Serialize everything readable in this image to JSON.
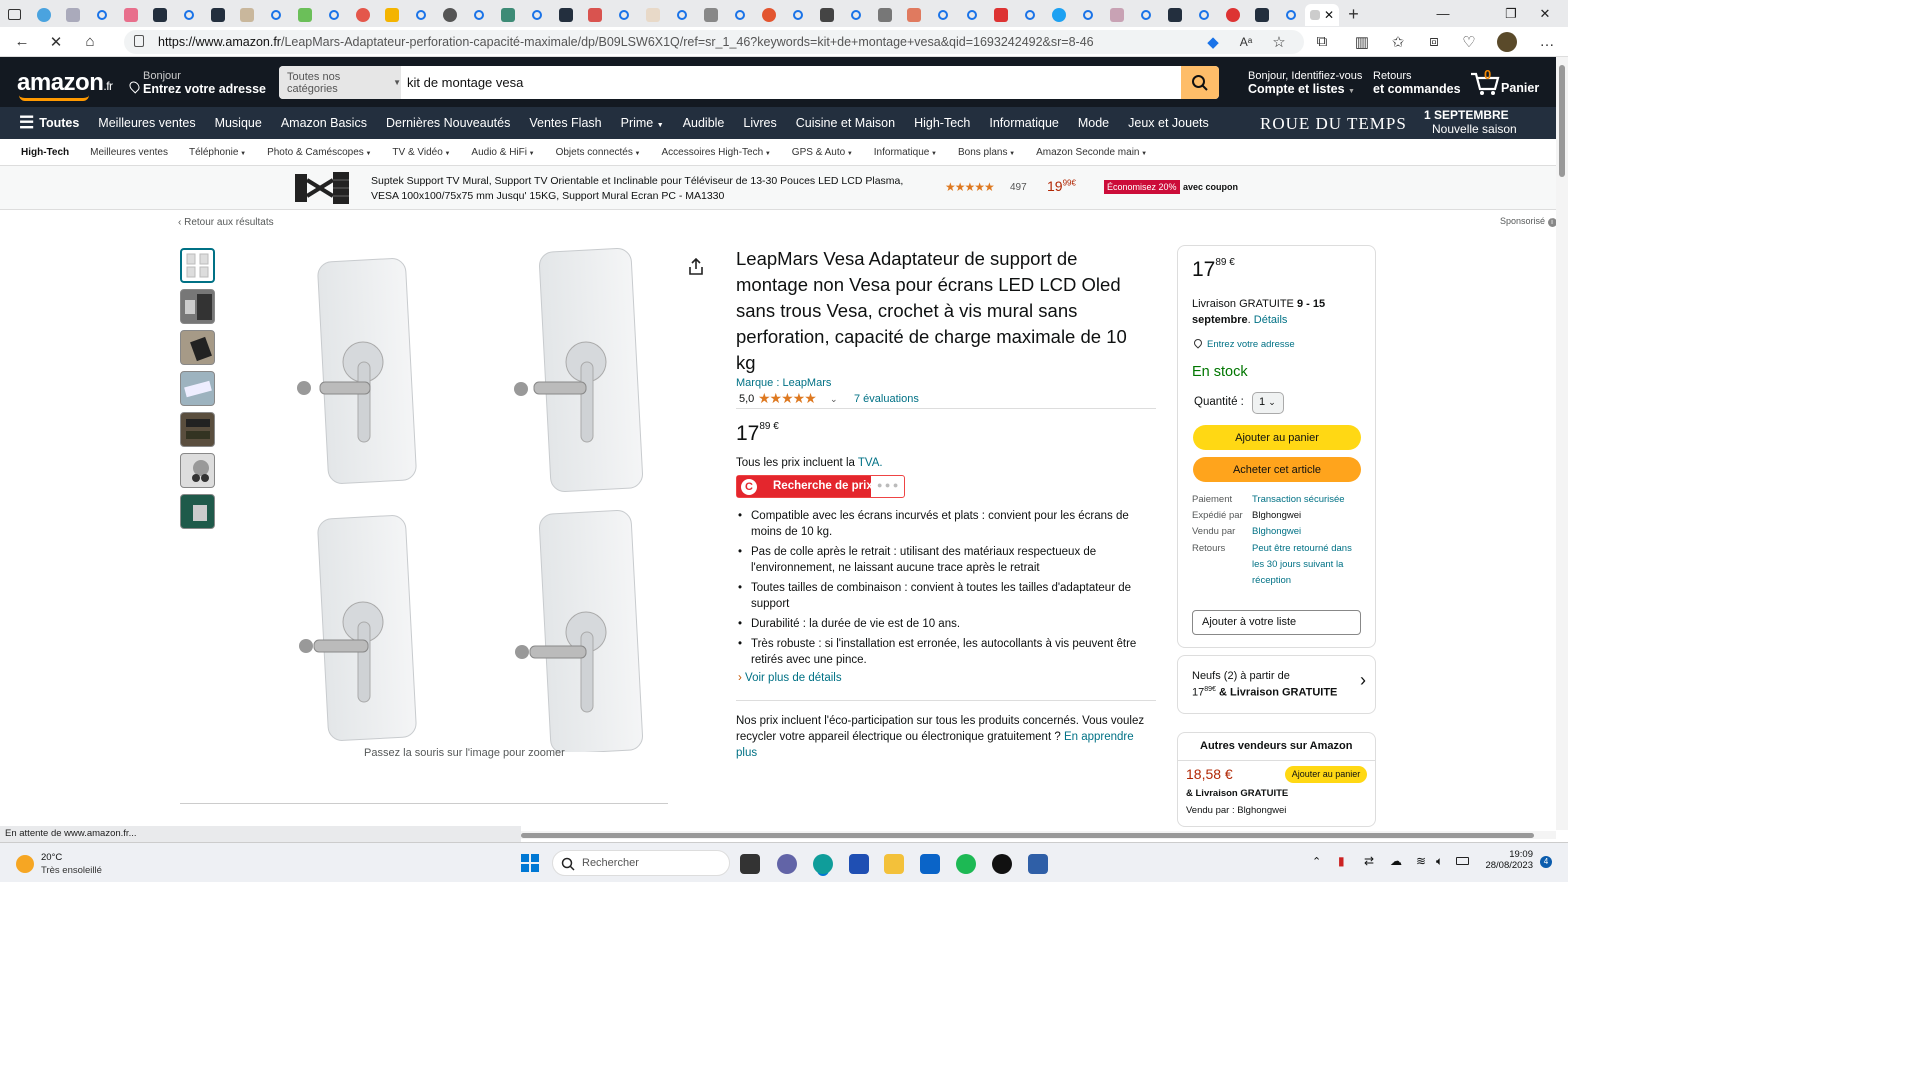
{
  "browser": {
    "url_domain": "https://www.amazon.fr",
    "url_path": "/LeapMars-Adaptateur-perforation-capacité-maximale/dp/B09LSW6X1Q/ref=sr_1_46?keywords=kit+de+montage+vesa&qid=1693242492&sr=8-46",
    "status_text": "En attente de www.amazon.fr..."
  },
  "header": {
    "logo": "amazon",
    "logo_suffix": ".fr",
    "deliver_line1": "Bonjour",
    "deliver_line2": "Entrez votre adresse",
    "search_category": "Toutes nos catégories",
    "search_value": "kit de montage vesa",
    "account_line1": "Bonjour, Identifiez-vous",
    "account_line2": "Compte et listes",
    "orders_line1": "Retours",
    "orders_line2": "et commandes",
    "cart_count": "0",
    "cart_label": "Panier"
  },
  "mainnav": {
    "all_label": "Toutes",
    "items": [
      "Meilleures ventes",
      "Musique",
      "Amazon Basics",
      "Dernières Nouveautés",
      "Ventes Flash",
      "Prime",
      "Audible",
      "Livres",
      "Cuisine et Maison",
      "High-Tech",
      "Informatique",
      "Mode",
      "Jeux et Jouets"
    ],
    "promo_title": "ROUE DU TEMPS",
    "promo_date": "1 SEPTEMBRE",
    "promo_sub": "Nouvelle saison"
  },
  "subnav": {
    "items": [
      "High-Tech",
      "Meilleures ventes",
      "Téléphonie",
      "Photo & Caméscopes",
      "TV & Vidéo",
      "Audio & HiFi",
      "Objets connectés",
      "Accessoires High-Tech",
      "GPS & Auto",
      "Informatique",
      "Bons plans",
      "Amazon Seconde main"
    ]
  },
  "banner": {
    "title_line1": "Suptek Support TV Mural, Support TV Orientable et Inclinable pour Téléviseur de 13-30 Pouces LED LCD Plasma,",
    "title_line2": "VESA 100x100/75x75 mm Jusqu' 15KG, Support Mural Ecran PC - MA1330",
    "rating_count": "497",
    "price_int": "19",
    "price_dec": "99",
    "currency": "€",
    "coupon": "Économisez 20%",
    "coupon_suffix": "avec coupon"
  },
  "page": {
    "back_link": "‹ Retour aux résultats",
    "sponsored": "Sponsorisé",
    "zoom_hint": "Passez la souris sur l'image pour zoomer"
  },
  "product": {
    "title": "LeapMars Vesa Adaptateur de support de montage non Vesa pour écrans LED LCD Oled sans trous Vesa, crochet à vis mural sans perforation, capacité de charge maximale de 10 kg",
    "brand": "Marque : LeapMars",
    "rating": "5,0",
    "reviews": "7 évaluations",
    "price_int": "17",
    "price_dec": "89",
    "currency": "€",
    "tax_text": "Tous les prix incluent la",
    "tax_link": "TVA.",
    "price_research": "Recherche de prix",
    "bullets": [
      "Compatible avec les écrans incurvés et plats : convient pour les écrans de moins de 10 kg.",
      "Pas de colle après le retrait : utilisant des matériaux respectueux de l'environnement, ne laissant aucune trace après le retrait",
      "Toutes tailles de combinaison : convient à toutes les tailles d'adaptateur de support",
      "Durabilité : la durée de vie est de 10 ans.",
      "Très robuste : si l'installation est erronée, les autocollants à vis peuvent être retirés avec une pince."
    ],
    "more_details": "Voir plus de détails",
    "eco_text": "Nos prix incluent l'éco-participation sur tous les produits concernés. Vous voulez recycler votre appareil électrique ou électronique gratuitement ?",
    "eco_link": "En apprendre plus"
  },
  "buybox": {
    "price_int": "17",
    "price_dec": "89",
    "currency": "€",
    "delivery_prefix": "Livraison GRATUITE",
    "delivery_dates": "9 - 15 septembre",
    "delivery_details": "Détails",
    "address": "Entrez votre adresse",
    "stock": "En stock",
    "qty_label": "Quantité :",
    "qty_value": "1",
    "add_cart": "Ajouter au panier",
    "buy_now": "Acheter cet article",
    "payment_label": "Paiement",
    "payment_value": "Transaction sécurisée",
    "ship_label": "Expédié par",
    "ship_value": "Blghongwei",
    "sold_label": "Vendu par",
    "sold_value": "Blghongwei",
    "returns_label": "Retours",
    "returns_value": "Peut être retourné dans les 30 jours suivant la réception",
    "add_list": "Ajouter à votre liste"
  },
  "newoffers": {
    "line1": "Neufs (2) à partir de",
    "price_int": "17",
    "price_dec": "89",
    "currency": "€",
    "line2_suffix": "& Livraison GRATUITE"
  },
  "othersellers": {
    "title": "Autres vendeurs sur Amazon",
    "price": "18,58 €",
    "add_btn": "Ajouter au panier",
    "delivery": "& Livraison GRATUITE",
    "sold_by": "Vendu par : Blghongwei"
  },
  "taskbar": {
    "temp": "20°C",
    "weather": "Très ensoleillé",
    "search": "Rechercher",
    "time": "19:09",
    "date": "28/08/2023",
    "notif_count": "4"
  }
}
